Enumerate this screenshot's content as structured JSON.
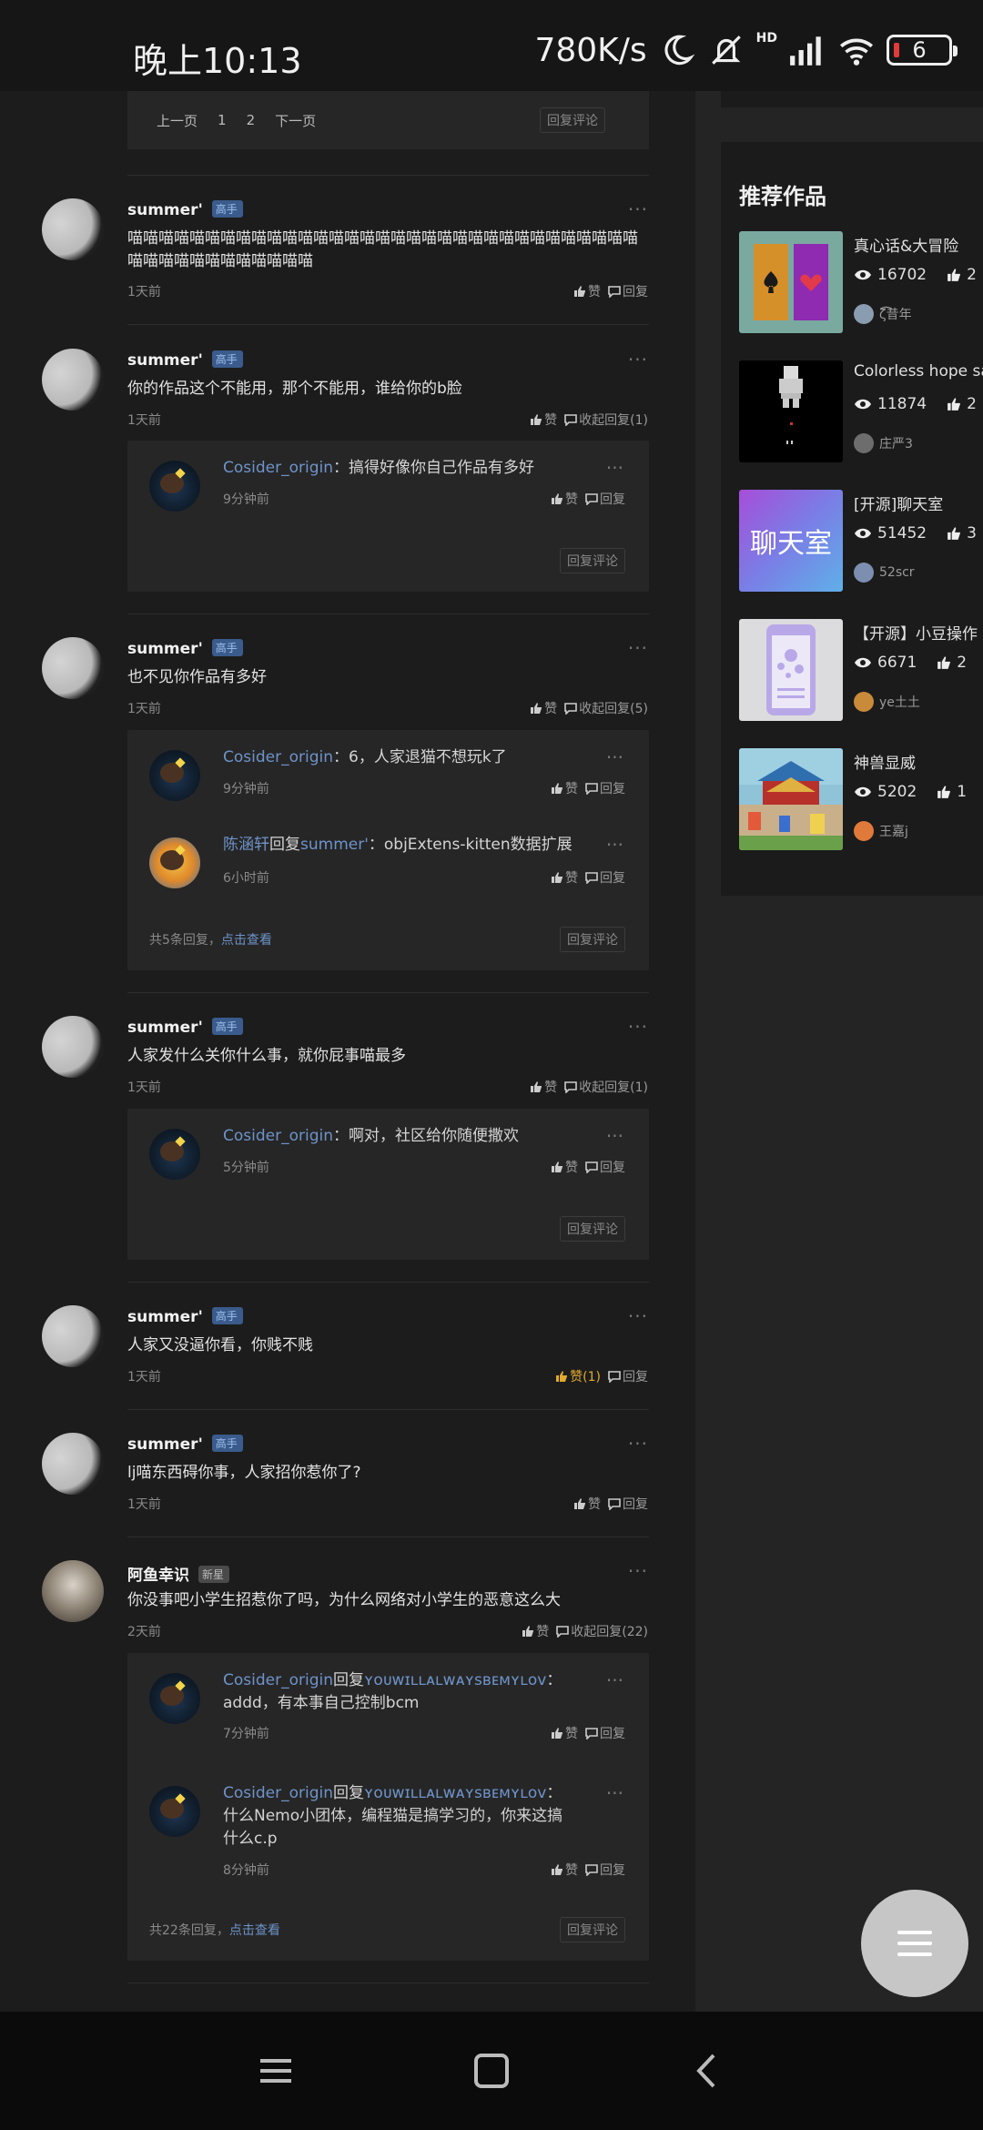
{
  "status": {
    "time": "晚上10:13",
    "speed": "780K/s",
    "signal_label": "HD",
    "battery": "6"
  },
  "pager": {
    "prev": "上一页",
    "page1": "1",
    "page2": "2",
    "next": "下一页",
    "reply": "回复评论"
  },
  "common": {
    "like": "赞",
    "reply": "回复",
    "reply_comment": "回复评论",
    "more": "···"
  },
  "comments": [
    {
      "name": "summer'",
      "badge": "高手",
      "text": "喵喵喵喵喵喵喵喵喵喵喵喵喵喵喵喵喵喵喵喵喵喵喵喵喵喵喵喵喵喵喵喵喵喵喵喵喵喵喵喵喵喵喵喵喵",
      "time": "1天前",
      "like": "赞",
      "reply": "回复"
    },
    {
      "name": "summer'",
      "badge": "高手",
      "text": "你的作品这个不能用，那个不能用，谁给你的b脸",
      "time": "1天前",
      "like": "赞",
      "collapse": "收起回复(1)",
      "replies": [
        {
          "user": "Cosider_origin",
          "text": "：搞得好像你自己作品有多好",
          "time": "9分钟前"
        }
      ]
    },
    {
      "name": "summer'",
      "badge": "高手",
      "text": "也不见你作品有多好",
      "time": "1天前",
      "like": "赞",
      "collapse": "收起回复(5)",
      "replies": [
        {
          "user": "Cosider_origin",
          "text": "：6，人家退猫不想玩k了",
          "time": "9分钟前"
        },
        {
          "user": "陈涵轩",
          "mid": "回复",
          "target": "summer'",
          "text": "：objExtens-kitten数据扩展",
          "time": "6小时前"
        }
      ],
      "footer": "共5条回复，",
      "footer_link": "点击查看"
    },
    {
      "name": "summer'",
      "badge": "高手",
      "text": "人家发什么关你什么事，就你屁事喵最多",
      "time": "1天前",
      "like": "赞",
      "collapse": "收起回复(1)",
      "replies": [
        {
          "user": "Cosider_origin",
          "text": "：啊对，社区给你随便撒欢",
          "time": "5分钟前"
        }
      ]
    },
    {
      "name": "summer'",
      "badge": "高手",
      "text": "人家又没逼你看，你贱不贱",
      "time": "1天前",
      "like": "赞(1)",
      "reply": "回复"
    },
    {
      "name": "summer'",
      "badge": "高手",
      "text": "lj喵东西碍你事，人家招你惹你了?",
      "time": "1天前",
      "like": "赞",
      "reply": "回复"
    },
    {
      "name": "阿鱼幸识",
      "badge": "新星",
      "text": "你没事吧小学生招惹你了吗，为什么网络对小学生的恶意这么大",
      "time": "2天前",
      "like": "赞",
      "collapse": "收起回复(22)",
      "replies": [
        {
          "user": "Cosider_origin",
          "mid": "回复",
          "target": "ʏᴏᴜᴡɪʟʟᴀʟᴡᴀʏsʙᴇᴍʏʟᴏᴠ",
          "text": "：addd，有本事自己控制bcm",
          "time": "7分钟前"
        },
        {
          "user": "Cosider_origin",
          "mid": "回复",
          "target": "ʏᴏᴜᴡɪʟʟᴀʟᴡᴀʏsʙᴇᴍʏʟᴏᴠ",
          "text": "：什么Nemo小团体，编程猫是搞学习的，你来这搞什么c.p",
          "time": "8分钟前"
        }
      ],
      "footer": "共22条回复，",
      "footer_link": "点击查看"
    }
  ],
  "recommend": {
    "title": "推荐作品",
    "works": [
      {
        "title": "真心话&大冒险",
        "views": "16702",
        "likes": "2",
        "author": "ζ͡͡͡昔年"
      },
      {
        "title": "Colorless hope sa",
        "views": "11874",
        "likes": "2",
        "author": "庄严3"
      },
      {
        "title": "[开源]聊天室",
        "views": "51452",
        "likes": "3",
        "author": "52scr",
        "thumb_text": "聊天室"
      },
      {
        "title": "【开源】小豆操作",
        "views": "6671",
        "likes": "2",
        "author": "ye土土"
      },
      {
        "title": "神兽显威",
        "views": "5202",
        "likes": "1",
        "author": "王嘉j"
      }
    ]
  },
  "colors": {
    "background": "#161616",
    "panel": "#262626",
    "link": "#6e93c9",
    "liked": "#e0a92f",
    "badge": "#3a5b8c"
  }
}
